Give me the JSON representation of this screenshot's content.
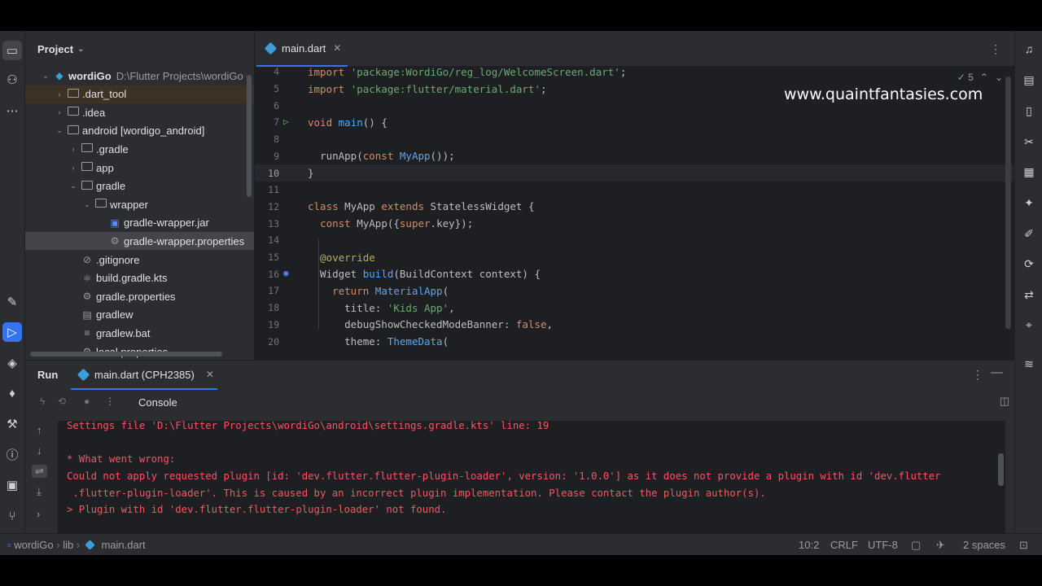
{
  "project_panel": {
    "title": "Project",
    "tree": [
      {
        "label": "wordiGo",
        "sub": "D:\\Flutter Projects\\wordiGo",
        "depth": 0,
        "arrow": "down",
        "icon": "flutter"
      },
      {
        "label": ".dart_tool",
        "depth": 1,
        "arrow": "right",
        "icon": "folder"
      },
      {
        "label": ".idea",
        "depth": 1,
        "arrow": "right",
        "icon": "folder"
      },
      {
        "label": "android [wordigo_android]",
        "depth": 1,
        "arrow": "down",
        "icon": "folder"
      },
      {
        "label": ".gradle",
        "depth": 2,
        "arrow": "right",
        "icon": "folder"
      },
      {
        "label": "app",
        "depth": 2,
        "arrow": "right",
        "icon": "folder"
      },
      {
        "label": "gradle",
        "depth": 2,
        "arrow": "down",
        "icon": "folder"
      },
      {
        "label": "wrapper",
        "depth": 3,
        "arrow": "down",
        "icon": "folder"
      },
      {
        "label": "gradle-wrapper.jar",
        "depth": 4,
        "arrow": "",
        "icon": "jar"
      },
      {
        "label": "gradle-wrapper.properties",
        "depth": 4,
        "arrow": "",
        "icon": "settings"
      },
      {
        "label": ".gitignore",
        "depth": 2,
        "arrow": "",
        "icon": "ignore"
      },
      {
        "label": "build.gradle.kts",
        "depth": 2,
        "arrow": "",
        "icon": "gradle"
      },
      {
        "label": "gradle.properties",
        "depth": 2,
        "arrow": "",
        "icon": "settings"
      },
      {
        "label": "gradlew",
        "depth": 2,
        "arrow": "",
        "icon": "terminal"
      },
      {
        "label": "gradlew.bat",
        "depth": 2,
        "arrow": "",
        "icon": "text"
      },
      {
        "label": "local.properties",
        "depth": 2,
        "arrow": "",
        "icon": "settings"
      }
    ]
  },
  "editor": {
    "tab": "main.dart",
    "inspections_count": "5",
    "current_line": "10",
    "lines": [
      {
        "n": "4",
        "tokens": [
          [
            "k",
            "import "
          ],
          [
            "s",
            "'package:WordiGo/reg_log/WelcomeScreen.dart'"
          ],
          [
            "c",
            ";"
          ]
        ]
      },
      {
        "n": "5",
        "tokens": [
          [
            "k",
            "import "
          ],
          [
            "s",
            "'package:flutter/material.dart'"
          ],
          [
            "c",
            ";"
          ]
        ]
      },
      {
        "n": "6",
        "tokens": []
      },
      {
        "n": "7",
        "tokens": [
          [
            "k",
            "void "
          ],
          [
            "t",
            "main"
          ],
          [
            "c",
            "() {"
          ]
        ],
        "gutter": "run"
      },
      {
        "n": "8",
        "tokens": []
      },
      {
        "n": "9",
        "tokens": [
          [
            "c",
            "  runApp("
          ],
          [
            "k",
            "const "
          ],
          [
            "t",
            "MyApp"
          ],
          [
            "c",
            "());"
          ]
        ]
      },
      {
        "n": "10",
        "tokens": [
          [
            "c",
            "}"
          ]
        ]
      },
      {
        "n": "11",
        "tokens": []
      },
      {
        "n": "12",
        "tokens": [
          [
            "k",
            "class "
          ],
          [
            "c",
            "MyApp "
          ],
          [
            "k",
            "extends "
          ],
          [
            "c",
            "StatelessWidget {"
          ]
        ]
      },
      {
        "n": "13",
        "tokens": [
          [
            "c",
            "  "
          ],
          [
            "k",
            "const "
          ],
          [
            "c",
            "MyApp({"
          ],
          [
            "k",
            "super"
          ],
          [
            "c",
            ".key});"
          ]
        ]
      },
      {
        "n": "14",
        "tokens": []
      },
      {
        "n": "15",
        "tokens": [
          [
            "a",
            "  @override"
          ]
        ]
      },
      {
        "n": "16",
        "tokens": [
          [
            "c",
            "  Widget "
          ],
          [
            "t",
            "build"
          ],
          [
            "c",
            "(BuildContext context) {"
          ]
        ],
        "gutter": "override"
      },
      {
        "n": "17",
        "tokens": [
          [
            "c",
            "    "
          ],
          [
            "k",
            "return "
          ],
          [
            "t",
            "MaterialApp"
          ],
          [
            "c",
            "("
          ]
        ]
      },
      {
        "n": "18",
        "tokens": [
          [
            "c",
            "      title: "
          ],
          [
            "s",
            "'Kids App'"
          ],
          [
            "c",
            ","
          ]
        ]
      },
      {
        "n": "19",
        "tokens": [
          [
            "c",
            "      debugShowCheckedModeBanner: "
          ],
          [
            "k",
            "false"
          ],
          [
            "c",
            ","
          ]
        ]
      },
      {
        "n": "20",
        "tokens": [
          [
            "c",
            "      theme: "
          ],
          [
            "t",
            "ThemeData"
          ],
          [
            "c",
            "("
          ]
        ]
      }
    ]
  },
  "watermark": "www.quaintfantasies.com",
  "run_panel": {
    "title": "Run",
    "tab": "main.dart (CPH2385)",
    "console_label": "Console",
    "console_lines": [
      "Settings file 'D:\\Flutter Projects\\wordiGo\\android\\settings.gradle.kts' line: 19",
      "",
      "* What went wrong:",
      "Could not apply requested plugin [id: 'dev.flutter.flutter-plugin-loader', version: '1.0.0'] as it does not provide a plugin with id 'dev.flutter",
      " .flutter-plugin-loader'. This is caused by an incorrect plugin implementation. Please contact the plugin author(s).",
      "> Plugin with id 'dev.flutter.flutter-plugin-loader' not found."
    ]
  },
  "status_bar": {
    "crumbs": [
      "wordiGo",
      "lib",
      "main.dart"
    ],
    "position": "10:2",
    "line_sep": "CRLF",
    "encoding": "UTF-8",
    "indent": "2 spaces"
  },
  "colors": {
    "accent": "#3574f0",
    "error_text": "#f75464",
    "keyword": "#cf8e6d",
    "string": "#6aab73",
    "function": "#56a8f5"
  }
}
